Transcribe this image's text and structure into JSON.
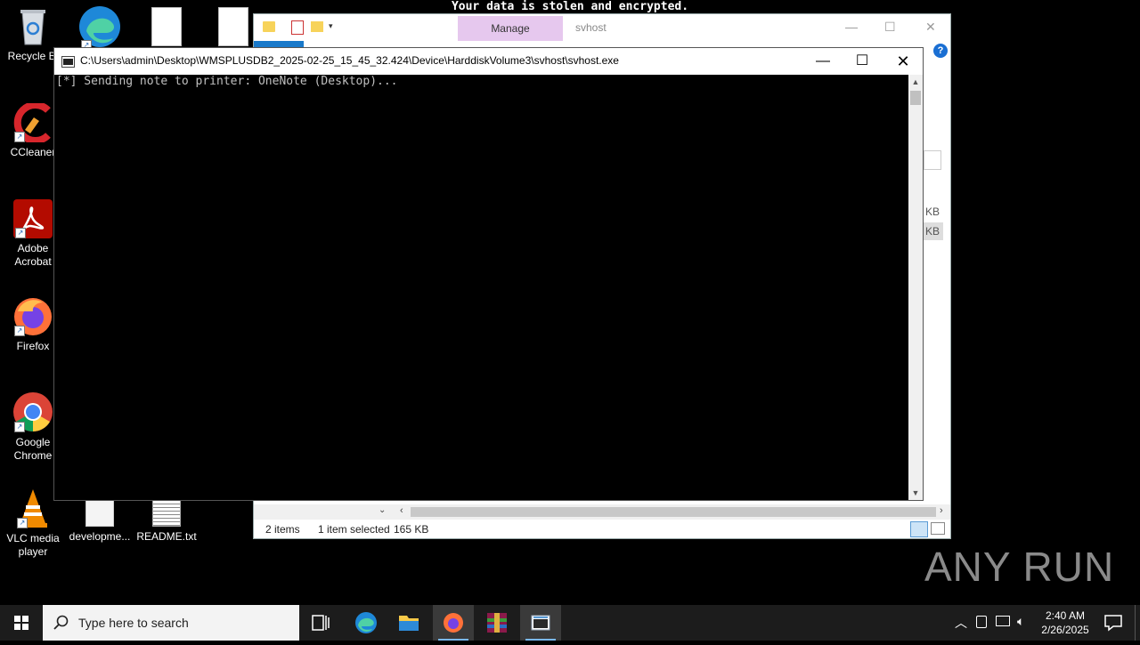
{
  "banner": "Your data is stolen and encrypted.",
  "desktop": {
    "icons": [
      {
        "label": "Recycle Bi",
        "icon": "recycle-bin-icon"
      },
      {
        "label": "CCleaner",
        "icon": "ccleaner-icon"
      },
      {
        "label": "Adobe\nAcrobat",
        "icon": "acrobat-icon"
      },
      {
        "label": "Firefox",
        "icon": "firefox-icon"
      },
      {
        "label": "Google\nChrome",
        "icon": "chrome-icon"
      },
      {
        "label": "VLC media\nplayer",
        "icon": "vlc-icon"
      },
      {
        "label": "developme...",
        "icon": "file-icon"
      },
      {
        "label": "README.txt",
        "icon": "text-file-icon"
      }
    ]
  },
  "explorer": {
    "manage_tab": "Manage",
    "title": "svhost",
    "size_labels": [
      "KB",
      "KB"
    ],
    "status": {
      "items": "2 items",
      "selected": "1 item selected",
      "size": "165 KB"
    }
  },
  "console": {
    "title": "C:\\Users\\admin\\Desktop\\WMSPLUSDB2_2025-02-25_15_45_32.424\\Device\\HarddiskVolume3\\svhost\\svhost.exe",
    "output": "[*] Sending note to printer: OneNote (Desktop)..."
  },
  "taskbar": {
    "search_placeholder": "Type here to search",
    "time": "2:40 AM",
    "date": "2/26/2025"
  },
  "watermark": "ANY RUN"
}
